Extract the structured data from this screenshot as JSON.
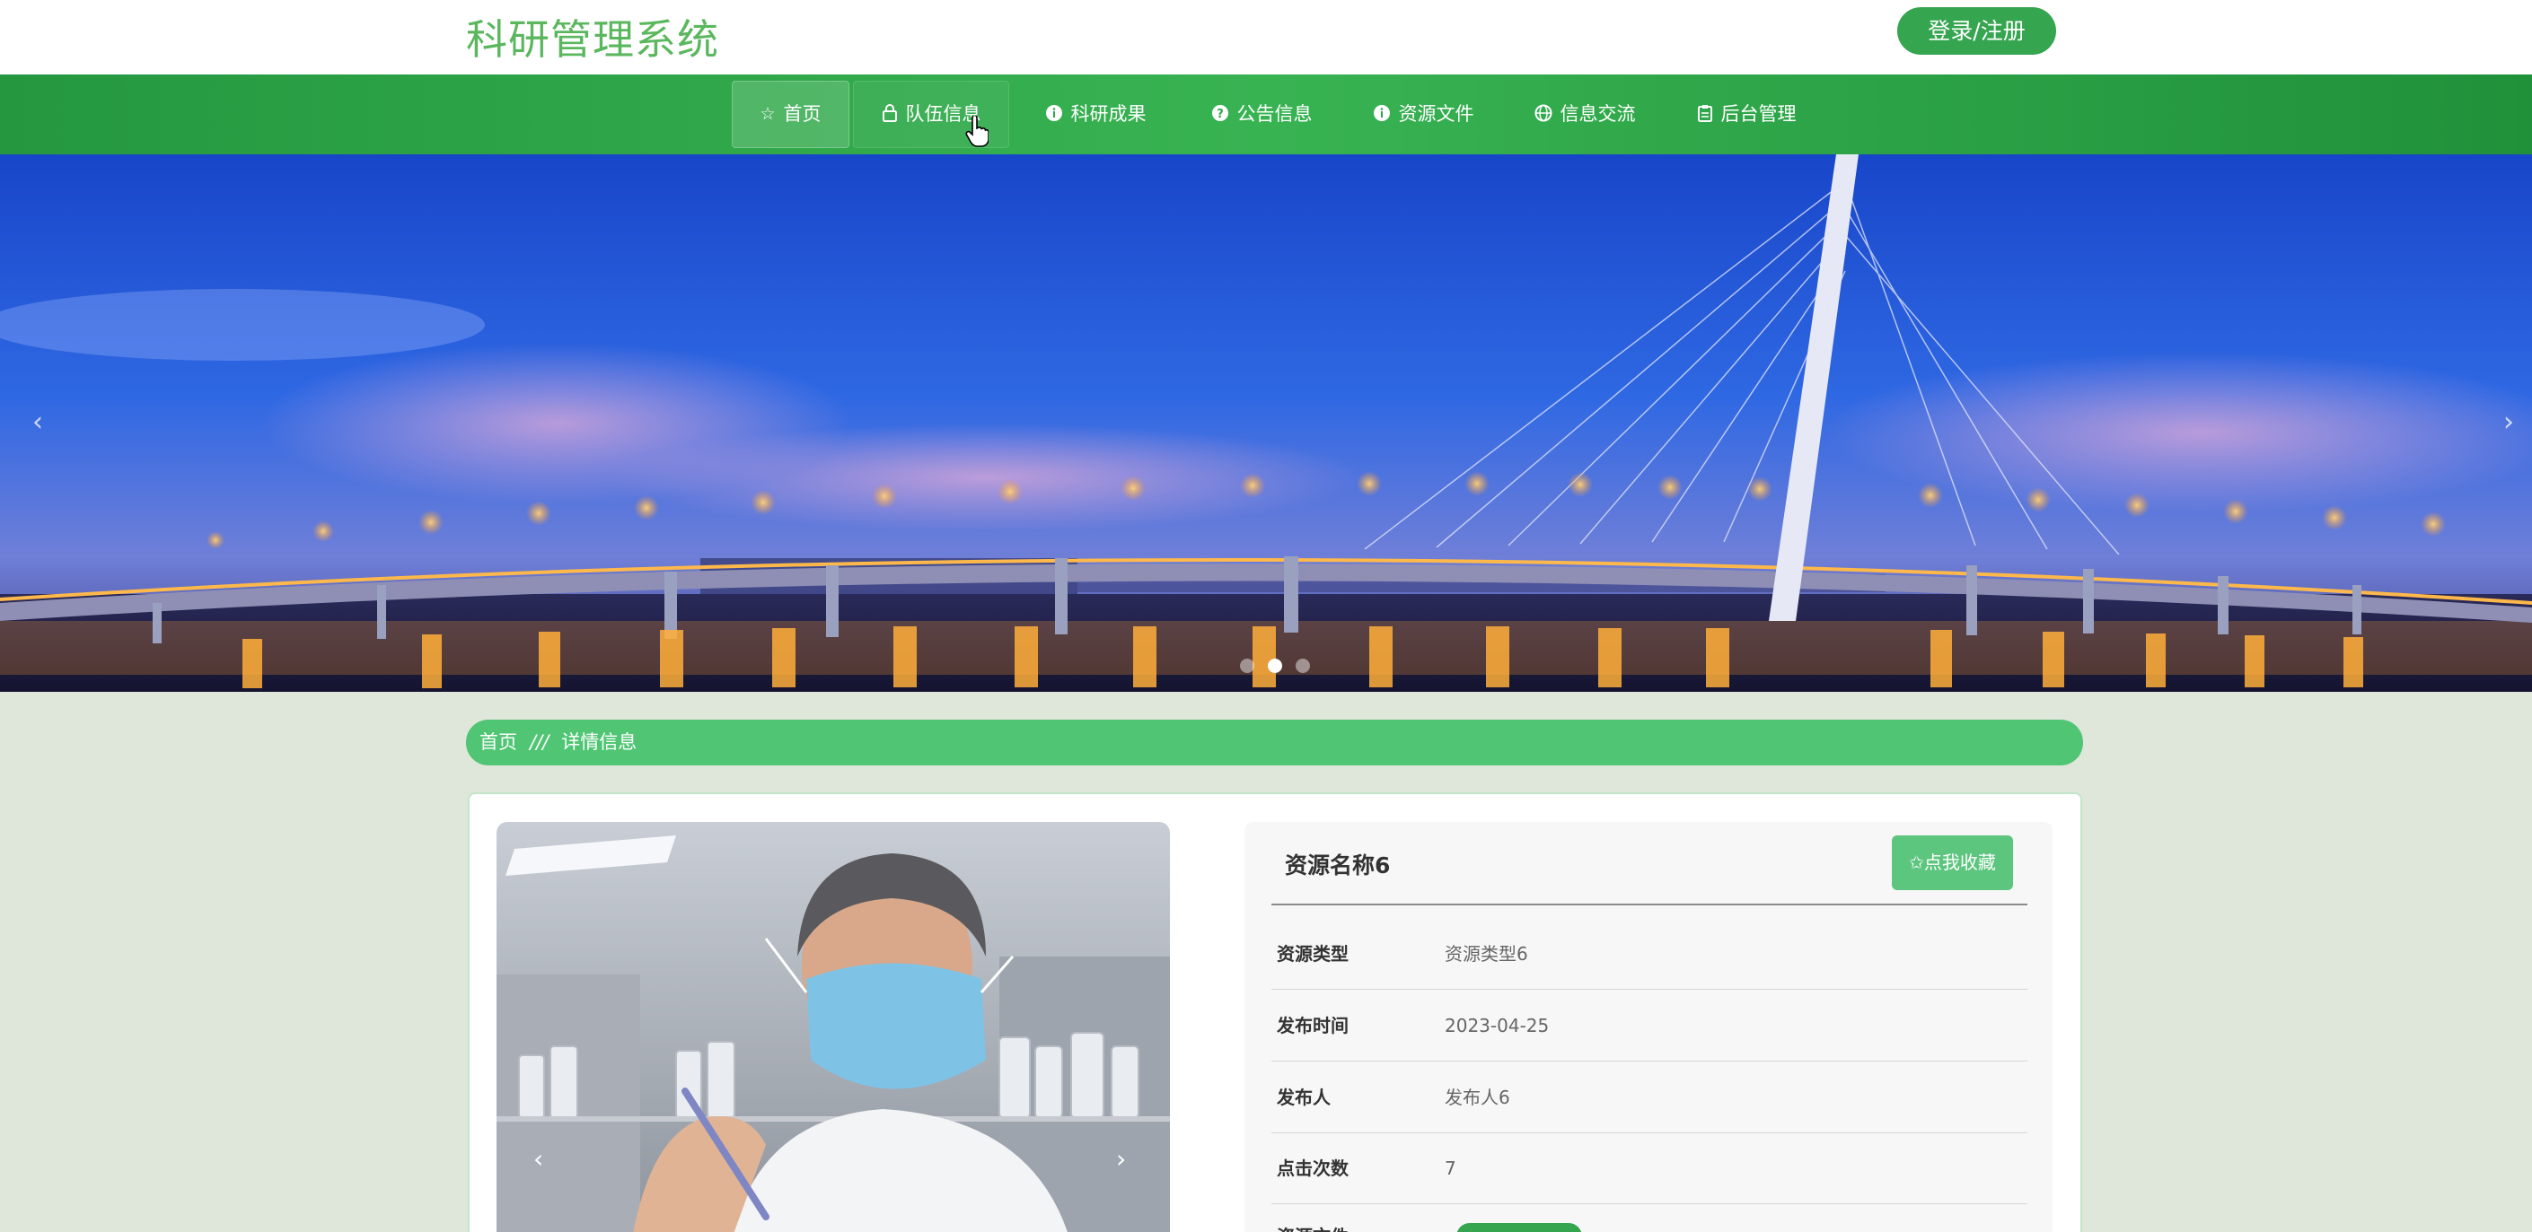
{
  "header": {
    "site_title": "科研管理系统",
    "login_label": "登录/注册"
  },
  "nav": {
    "items": [
      {
        "label": "首页",
        "icon": "star-outline-icon",
        "glyph": "☆"
      },
      {
        "label": "队伍信息",
        "icon": "lock-icon",
        "glyph": "🔒︎"
      },
      {
        "label": "科研成果",
        "icon": "info-circle-icon",
        "glyph": "❶"
      },
      {
        "label": "公告信息",
        "icon": "question-circle-icon",
        "glyph": "❷"
      },
      {
        "label": "资源文件",
        "icon": "info-circle-icon",
        "glyph": "❸"
      },
      {
        "label": "信息交流",
        "icon": "globe-icon",
        "glyph": "⊕"
      },
      {
        "label": "后台管理",
        "icon": "clipboard-icon",
        "glyph": "▣"
      }
    ],
    "active_index": 0,
    "hover_index": 1
  },
  "banner": {
    "prev_glyph": "‹",
    "next_glyph": "›",
    "slide_count": 3,
    "active_slide": 1
  },
  "breadcrumb": {
    "home": "首页",
    "separator": "///",
    "current": "详情信息"
  },
  "detail": {
    "title": "资源名称6",
    "favorite_label": "✩点我收藏",
    "photo_prev": "‹",
    "photo_next": "›",
    "fields": [
      {
        "label": "资源类型",
        "value": "资源类型6"
      },
      {
        "label": "发布时间",
        "value": "2023-04-25"
      },
      {
        "label": "发布人",
        "value": "发布人6"
      },
      {
        "label": "点击次数",
        "value": "7"
      }
    ],
    "partial_field_label": "资源文件"
  },
  "colors": {
    "brand_green": "#36a550",
    "title_green": "#5bb75e",
    "breadcrumb_green": "#50c674",
    "page_bg": "#dfe6da"
  }
}
